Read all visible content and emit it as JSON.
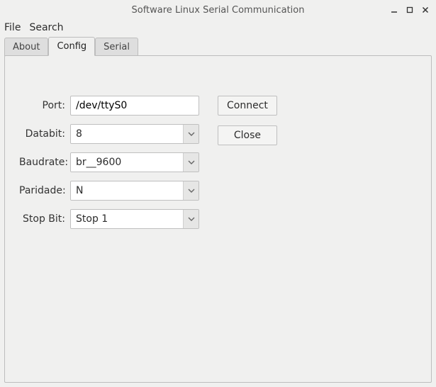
{
  "window": {
    "title": "Software Linux Serial Communication"
  },
  "menu": {
    "file": "File",
    "search": "Search"
  },
  "tabs": {
    "about": "About",
    "config": "Config",
    "serial": "Serial"
  },
  "form": {
    "port_label": "Port:",
    "port_value": "/dev/ttyS0",
    "databit_label": "Databit:",
    "databit_value": "8",
    "baudrate_label": "Baudrate:",
    "baudrate_value": "br__9600",
    "parity_label": "Paridade:",
    "parity_value": "N",
    "stopbit_label": "Stop Bit:",
    "stopbit_value": "Stop 1"
  },
  "buttons": {
    "connect": "Connect",
    "close": "Close"
  }
}
